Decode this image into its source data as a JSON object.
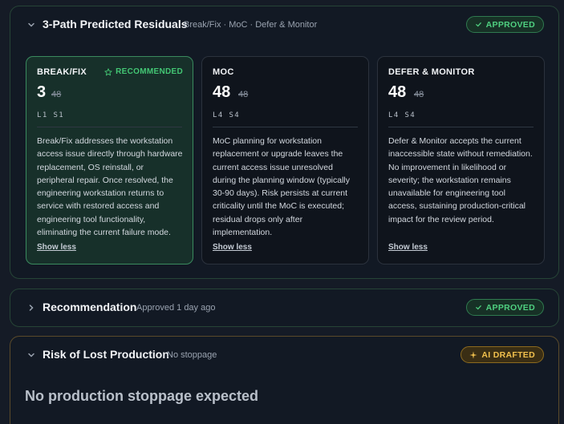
{
  "residuals": {
    "title": "3-Path Predicted Residuals",
    "subtitle": "Break/Fix · MoC · Defer & Monitor",
    "badge": "APPROVED",
    "cards": [
      {
        "name": "BREAK/FIX",
        "tag": "RECOMMENDED",
        "score": "3",
        "prev_score": "48",
        "levels": "L1 S1",
        "description": "Break/Fix addresses the workstation access issue directly through hardware replacement, OS reinstall, or peripheral repair. Once resolved, the engineering workstation returns to service with restored access and engineering tool functionality, eliminating the current failure mode.",
        "link": "Show less"
      },
      {
        "name": "MOC",
        "score": "48",
        "prev_score": "48",
        "levels": "L4 S4",
        "description": "MoC planning for workstation replacement or upgrade leaves the current access issue unresolved during the planning window (typically 30-90 days). Risk persists at current criticality until the MoC is executed; residual drops only after implementation.",
        "link": "Show less"
      },
      {
        "name": "DEFER & MONITOR",
        "score": "48",
        "prev_score": "48",
        "levels": "L4 S4",
        "description": "Defer & Monitor accepts the current inaccessible state without remediation. No improvement in likelihood or severity; the workstation remains unavailable for engineering tool access, sustaining production-critical impact for the review period.",
        "link": "Show less"
      }
    ]
  },
  "recommendation": {
    "title": "Recommendation",
    "subtitle": "Approved 1 day ago",
    "badge": "APPROVED"
  },
  "risk": {
    "title": "Risk of Lost Production",
    "subtitle": "No stoppage",
    "badge": "AI DRAFTED",
    "body": "No production stoppage expected"
  },
  "icons": {
    "chevron_down": "chevron-down-icon",
    "chevron_right": "chevron-right-icon",
    "check": "check-icon",
    "star": "star-icon",
    "sparkle": "sparkle-icon"
  },
  "colors": {
    "approved": "#4fd080",
    "recommended": "#43c774",
    "ai_drafted": "#f1c04d"
  }
}
